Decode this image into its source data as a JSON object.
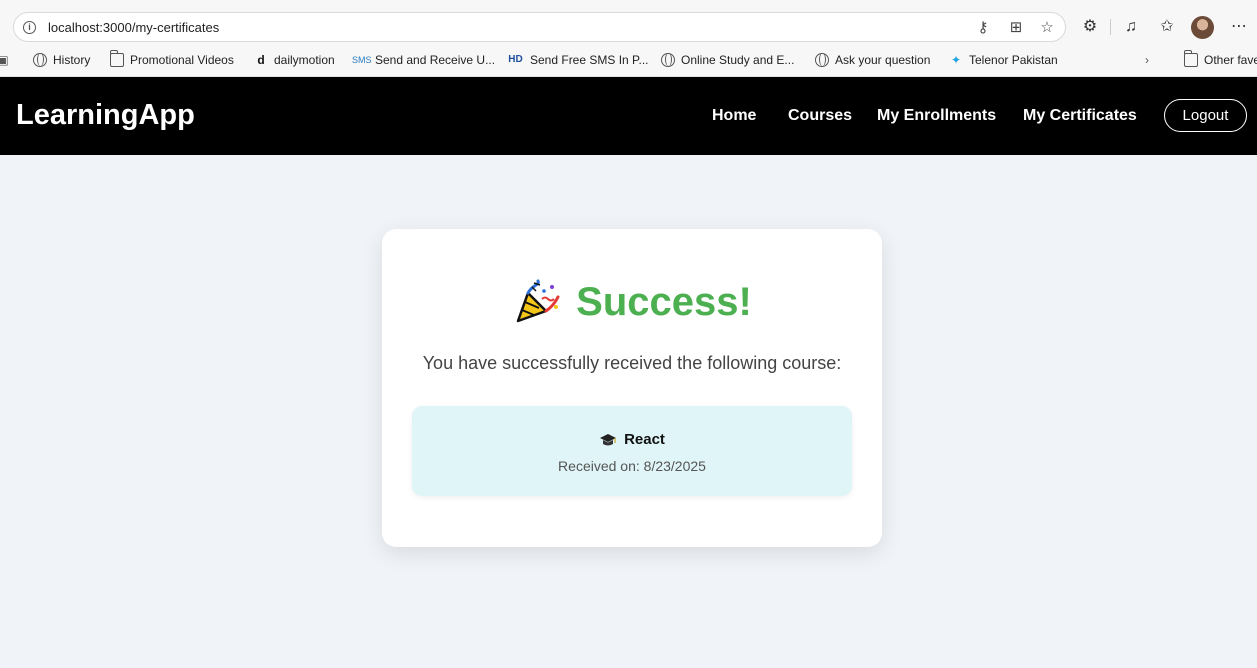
{
  "browser": {
    "url": "localhost:3000/my-certificates",
    "bookmarks": [
      {
        "label": "History",
        "icon": "globe-icon"
      },
      {
        "label": "Promotional Videos",
        "icon": "folder-icon"
      },
      {
        "label": "dailymotion",
        "icon": "dailymotion-icon"
      },
      {
        "label": "Send and Receive U...",
        "icon": "sms-icon"
      },
      {
        "label": "Send Free SMS In P...",
        "icon": "hd-icon"
      },
      {
        "label": "Online Study and E...",
        "icon": "globe-icon"
      },
      {
        "label": "Ask your question",
        "icon": "globe-icon"
      },
      {
        "label": "Telenor Pakistan",
        "icon": "telenor-icon"
      }
    ],
    "other_favorites": "Other fave"
  },
  "navbar": {
    "brand": "LearningApp",
    "links": [
      "Home",
      "Courses",
      "My Enrollments",
      "My Certificates"
    ],
    "logout_label": "Logout"
  },
  "card": {
    "title": "Success!",
    "subtitle": "You have successfully received the following course:",
    "course": {
      "name": "React",
      "received": "Received on: 8/23/2025"
    }
  },
  "colors": {
    "success": "#4caf50",
    "navbar_bg": "#000000",
    "course_box_bg": "#e0f5f7",
    "page_bg": "#f0f3f7"
  }
}
